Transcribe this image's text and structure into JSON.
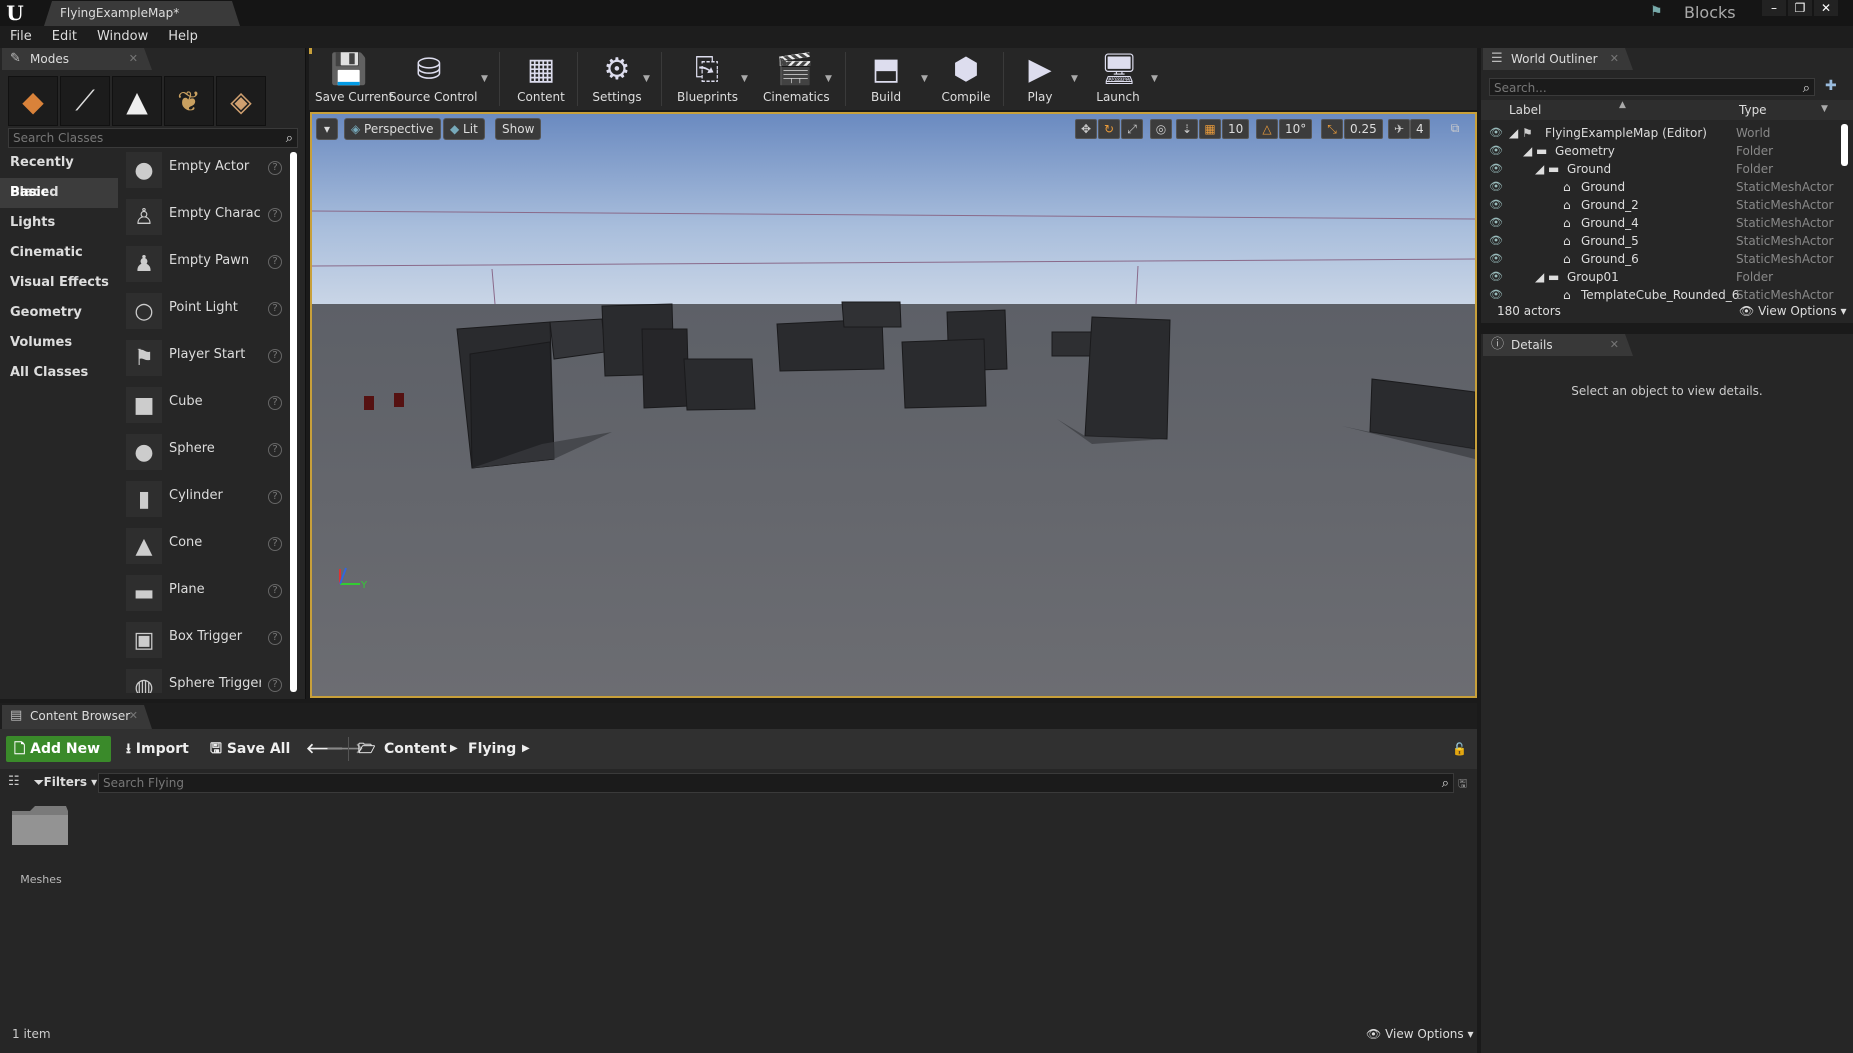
{
  "title_bar": {
    "tab_title": "FlyingExampleMap*",
    "project": "Blocks",
    "window_buttons": [
      "–",
      "❐",
      "✕"
    ]
  },
  "menu": [
    "File",
    "Edit",
    "Window",
    "Help"
  ],
  "modes": {
    "tab": "Modes",
    "search_placeholder": "Search Classes",
    "categories": [
      "Recently Placed",
      "Basic",
      "Lights",
      "Cinematic",
      "Visual Effects",
      "Geometry",
      "Volumes",
      "All Classes"
    ],
    "active_category": "Basic",
    "items": [
      {
        "label": "Empty Actor",
        "icon": "sphere-icon"
      },
      {
        "label": "Empty Characte",
        "icon": "character-icon"
      },
      {
        "label": "Empty Pawn",
        "icon": "pawn-icon"
      },
      {
        "label": "Point Light",
        "icon": "lightbulb-icon"
      },
      {
        "label": "Player Start",
        "icon": "player-start-icon"
      },
      {
        "label": "Cube",
        "icon": "cube-icon"
      },
      {
        "label": "Sphere",
        "icon": "sphere-icon"
      },
      {
        "label": "Cylinder",
        "icon": "cylinder-icon"
      },
      {
        "label": "Cone",
        "icon": "cone-icon"
      },
      {
        "label": "Plane",
        "icon": "plane-icon"
      },
      {
        "label": "Box Trigger",
        "icon": "box-trigger-icon"
      },
      {
        "label": "Sphere Trigger",
        "icon": "sphere-trigger-icon"
      }
    ]
  },
  "toolbar": {
    "buttons": [
      "Save Current",
      "Source Control",
      "Content",
      "Settings",
      "Blueprints",
      "Cinematics",
      "Build",
      "Compile",
      "Play",
      "Launch"
    ]
  },
  "viewport": {
    "perspective": "Perspective",
    "lit": "Lit",
    "show": "Show",
    "grid_snap": "10",
    "rotation_snap": "10°",
    "scale_snap": "0.25",
    "camera_speed": "4",
    "axis_y": "Y"
  },
  "outliner": {
    "tab": "World Outliner",
    "search_placeholder": "Search...",
    "col_label": "Label",
    "col_type": "Type",
    "rows": [
      {
        "label": "FlyingExampleMap (Editor)",
        "type": "World"
      },
      {
        "label": "Geometry",
        "type": "Folder"
      },
      {
        "label": "Ground",
        "type": "Folder"
      },
      {
        "label": "Ground",
        "type": "StaticMeshActor"
      },
      {
        "label": "Ground_2",
        "type": "StaticMeshActor"
      },
      {
        "label": "Ground_4",
        "type": "StaticMeshActor"
      },
      {
        "label": "Ground_5",
        "type": "StaticMeshActor"
      },
      {
        "label": "Ground_6",
        "type": "StaticMeshActor"
      },
      {
        "label": "Group01",
        "type": "Folder"
      },
      {
        "label": "TemplateCube_Rounded_6",
        "type": "StaticMeshActor"
      }
    ],
    "actor_count": "180 actors",
    "view_options": "View Options"
  },
  "details": {
    "tab": "Details",
    "empty_message": "Select an object to view details."
  },
  "content_browser": {
    "tab": "Content Browser",
    "add_new": "Add New",
    "import": "Import",
    "save_all": "Save All",
    "path": [
      "Content",
      "Flying"
    ],
    "filters": "Filters",
    "search_placeholder": "Search Flying",
    "folder": "Meshes",
    "item_count": "1 item",
    "view_options": "View Options"
  }
}
